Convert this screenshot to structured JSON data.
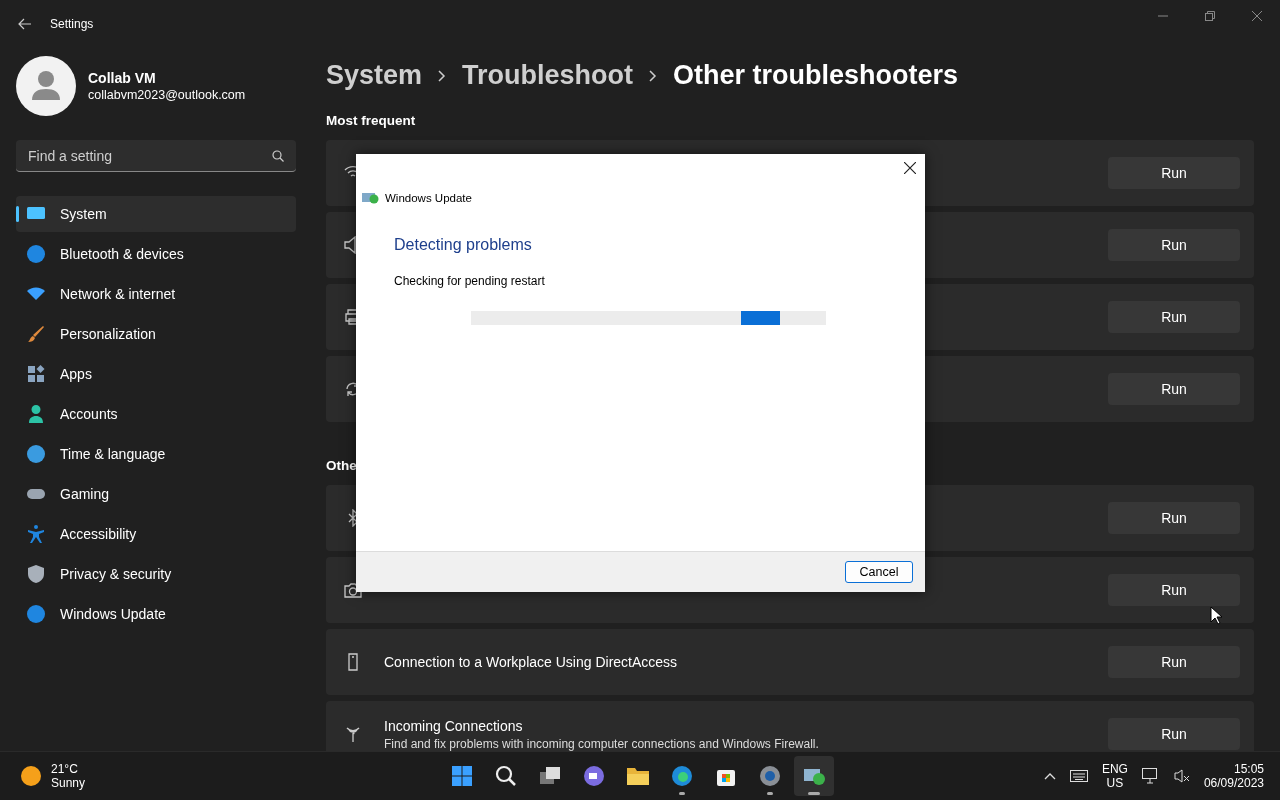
{
  "window": {
    "title": "Settings"
  },
  "account": {
    "name": "Collab VM",
    "email": "collabvm2023@outlook.com"
  },
  "search": {
    "placeholder": "Find a setting"
  },
  "sidebar": {
    "items": [
      {
        "label": "System",
        "selected": true
      },
      {
        "label": "Bluetooth & devices",
        "selected": false
      },
      {
        "label": "Network & internet",
        "selected": false
      },
      {
        "label": "Personalization",
        "selected": false
      },
      {
        "label": "Apps",
        "selected": false
      },
      {
        "label": "Accounts",
        "selected": false
      },
      {
        "label": "Time & language",
        "selected": false
      },
      {
        "label": "Gaming",
        "selected": false
      },
      {
        "label": "Accessibility",
        "selected": false
      },
      {
        "label": "Privacy & security",
        "selected": false
      },
      {
        "label": "Windows Update",
        "selected": false
      }
    ]
  },
  "breadcrumb": [
    "System",
    "Troubleshoot",
    "Other troubleshooters"
  ],
  "sections": [
    {
      "title": "Most frequent",
      "rows": [
        {
          "button": "Run"
        },
        {
          "button": "Run"
        },
        {
          "button": "Run"
        },
        {
          "button": "Run"
        }
      ]
    },
    {
      "title": "Othe",
      "rows": [
        {
          "button": "Run"
        },
        {
          "button": "Run"
        },
        {
          "title": "Connection to a Workplace Using DirectAccess",
          "button": "Run"
        },
        {
          "title": "Incoming Connections",
          "description": "Find and fix problems with incoming computer connections and Windows Firewall.",
          "button": "Run"
        }
      ]
    }
  ],
  "dialog": {
    "title": "Windows Update",
    "heading": "Detecting problems",
    "status": "Checking for pending restart",
    "button": "Cancel",
    "progress": {
      "level": 0.87
    }
  },
  "taskbar": {
    "weather": {
      "temperature": "21°C",
      "condition": "Sunny"
    },
    "apps": [
      {
        "running": false,
        "selected": false
      },
      {
        "running": false,
        "selected": false
      },
      {
        "running": false,
        "selected": false
      },
      {
        "running": false,
        "selected": false
      },
      {
        "running": false,
        "selected": false
      },
      {
        "running": true,
        "selected": false
      },
      {
        "running": false,
        "selected": false
      },
      {
        "running": true,
        "selected": false
      },
      {
        "running": true,
        "selected": true
      }
    ],
    "language": [
      "ENG",
      "US"
    ],
    "time": "15:05",
    "date": "06/09/2023"
  }
}
